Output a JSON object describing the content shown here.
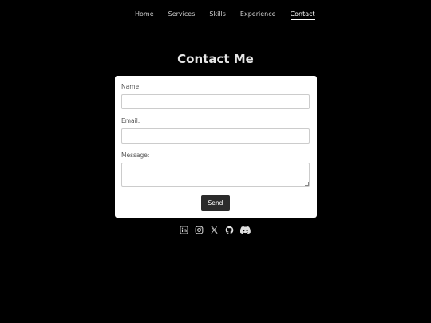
{
  "nav": {
    "items": [
      {
        "label": "Home"
      },
      {
        "label": "Services"
      },
      {
        "label": "Skills"
      },
      {
        "label": "Experience"
      },
      {
        "label": "Contact",
        "active": true
      }
    ]
  },
  "contact": {
    "title": "Contact Me",
    "name_label": "Name:",
    "name_value": "",
    "email_label": "Email:",
    "email_value": "",
    "message_label": "Message:",
    "message_value": "",
    "send_label": "Send"
  },
  "socials": [
    {
      "icon": "linkedin-icon"
    },
    {
      "icon": "instagram-icon"
    },
    {
      "icon": "x-twitter-icon"
    },
    {
      "icon": "github-icon"
    },
    {
      "icon": "discord-icon"
    }
  ],
  "colors": {
    "background": "#000000",
    "card": "#ffffff",
    "button": "#2b2b2b",
    "nav_text": "#cfcfcf",
    "active_nav": "#ffffff"
  }
}
